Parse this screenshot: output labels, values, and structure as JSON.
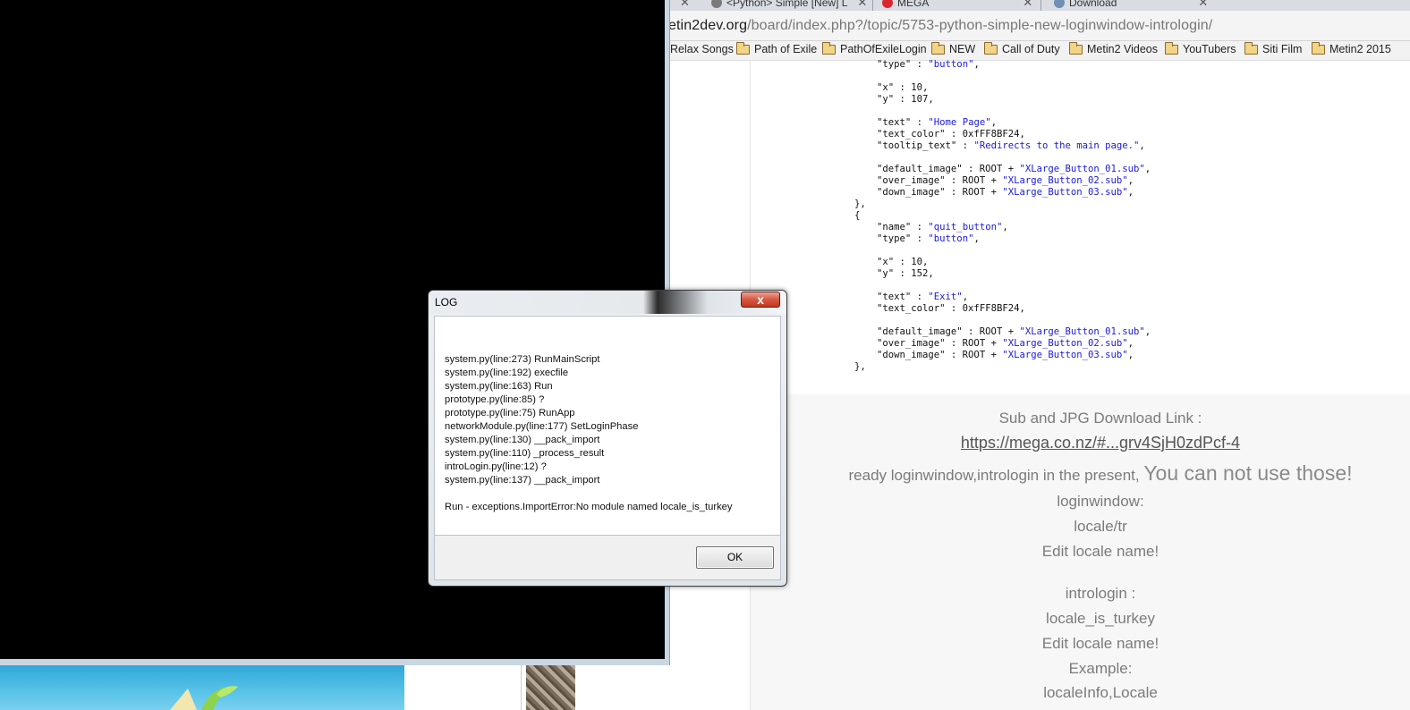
{
  "browser": {
    "tabs": [
      {
        "label": "<Python> Simple [New] L",
        "icon": "gear-icon"
      },
      {
        "label": "MEGA",
        "icon": "mega-icon"
      },
      {
        "label": "Download",
        "icon": "download-icon"
      }
    ],
    "url_host": "etin2dev.org",
    "url_path": "/board/index.php?/topic/5753-python-simple-new-loginwindow-intrologin/",
    "bookmarks": [
      "Relax Songs",
      "Path of Exile",
      "PathOfExileLogin",
      "NEW",
      "Call of Duty",
      "Metin2 Videos",
      "YouTubers",
      "Siti Film",
      "Metin2 2015"
    ]
  },
  "code": {
    "lines": [
      {
        "t": "\"type\" : \"button\","
      },
      {
        "t": "\"x\" : 10,"
      },
      {
        "t": "\"y\" : 107,"
      },
      {
        "t": "\"text\" : \"Home Page\","
      },
      {
        "t": "\"text_color\" : 0xfFF8BF24,"
      },
      {
        "t": "\"tooltip_text\" : \"Redirects to the main page.\","
      },
      {
        "t": "\"default_image\" : ROOT + \"XLarge_Button_01.sub\","
      },
      {
        "t": "\"over_image\" : ROOT + \"XLarge_Button_02.sub\","
      },
      {
        "t": "\"down_image\" : ROOT + \"XLarge_Button_03.sub\","
      },
      {
        "t": "},"
      },
      {
        "t": "{"
      },
      {
        "t": "\"name\" : \"quit_button\","
      },
      {
        "t": "\"type\" : \"button\","
      },
      {
        "t": "\"x\" : 10,"
      },
      {
        "t": "\"y\" : 152,"
      },
      {
        "t": "\"text\" : \"Exit\","
      },
      {
        "t": "\"text_color\" : 0xfFF8BF24,"
      },
      {
        "t": "\"default_image\" : ROOT + \"XLarge_Button_01.sub\","
      },
      {
        "t": "\"over_image\" : ROOT + \"XLarge_Button_02.sub\","
      },
      {
        "t": "\"down_image\" : ROOT + \"XLarge_Button_03.sub\","
      },
      {
        "t": "},"
      }
    ]
  },
  "post": {
    "download_heading": "Sub and JPG Download Link :",
    "download_link": "https://mega.co.nz/#...grv4SjH0zdPcf-4",
    "warning_small": "ready loginwindow,intrologin in the present, ",
    "warning_big": "You can not use those!",
    "loginwindow_label": "loginwindow:",
    "loginwindow_path": "locale/tr",
    "edit_locale_1": "Edit locale name!",
    "intrologin_label": "intrologin :",
    "intrologin_value": "locale_is_turkey",
    "edit_locale_2": "Edit locale name!",
    "example_label": "Example:",
    "example_value": "localeInfo,Locale"
  },
  "dialog": {
    "title": "LOG",
    "close_glyph": "x",
    "lines": [
      "system.py(line:273) RunMainScript",
      "system.py(line:192) execfile",
      "system.py(line:163) Run",
      "prototype.py(line:85) ?",
      "prototype.py(line:75) RunApp",
      "networkModule.py(line:177) SetLoginPhase",
      "system.py(line:130) __pack_import",
      "system.py(line:110) _process_result",
      "introLogin.py(line:12) ?",
      "system.py(line:137) __pack_import"
    ],
    "error": "Run - exceptions.ImportError:No module named locale_is_turkey",
    "ok_label": "OK"
  }
}
